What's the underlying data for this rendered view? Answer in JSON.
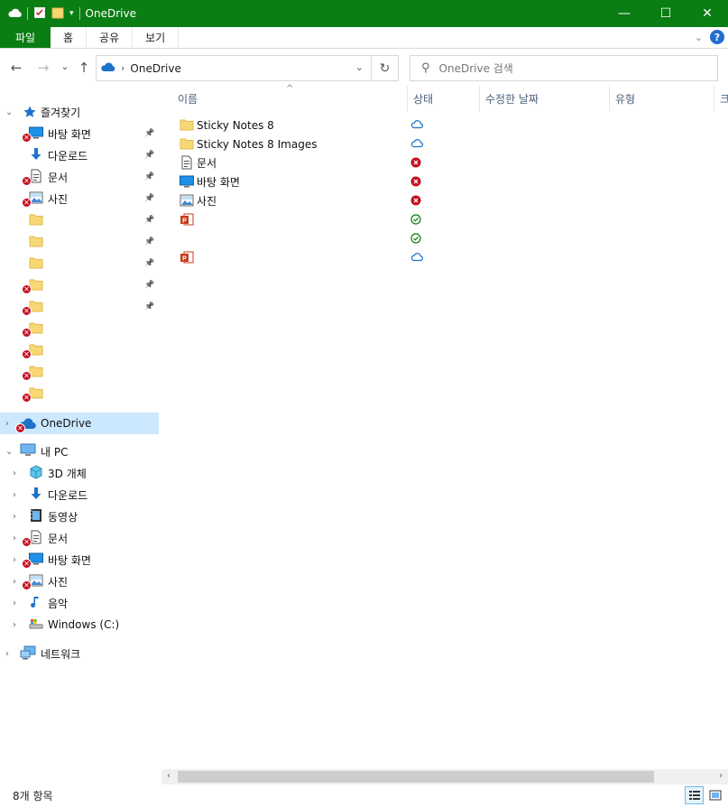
{
  "window": {
    "title": "OneDrive",
    "minimize_label": "—",
    "maximize_label": "☐",
    "close_label": "✕"
  },
  "ribbon": {
    "tabs": [
      "파일",
      "홈",
      "공유",
      "보기"
    ]
  },
  "navigation": {
    "back_label": "←",
    "forward_label": "→",
    "recent_label": "⌄",
    "up_label": "↑",
    "address_crumbs": [
      "OneDrive"
    ],
    "refresh_label": "↻",
    "search_placeholder": "OneDrive 검색"
  },
  "sidebar": {
    "quick_access_label": "즐겨찾기",
    "quick_access_items": [
      {
        "label": "바탕 화면",
        "icon": "desktop-icon",
        "pinned": true,
        "error": true
      },
      {
        "label": "다운로드",
        "icon": "download-icon",
        "pinned": true,
        "error": false
      },
      {
        "label": "문서",
        "icon": "document-icon",
        "pinned": true,
        "error": true
      },
      {
        "label": "사진",
        "icon": "pictures-icon",
        "pinned": true,
        "error": true
      },
      {
        "label": "",
        "icon": "folder-icon",
        "pinned": true,
        "error": false
      },
      {
        "label": "",
        "icon": "folder-icon",
        "pinned": true,
        "error": false
      },
      {
        "label": "",
        "icon": "folder-icon",
        "pinned": true,
        "error": false
      },
      {
        "label": "",
        "icon": "folder-icon",
        "pinned": true,
        "error": true
      },
      {
        "label": "",
        "icon": "folder-icon",
        "pinned": true,
        "error": true
      },
      {
        "label": "",
        "icon": "folder-icon",
        "pinned": false,
        "error": true
      },
      {
        "label": "",
        "icon": "folder-icon",
        "pinned": false,
        "error": true
      },
      {
        "label": "",
        "icon": "folder-icon",
        "pinned": false,
        "error": true
      },
      {
        "label": "",
        "icon": "folder-icon",
        "pinned": false,
        "error": true
      }
    ],
    "onedrive_label": "OneDrive",
    "this_pc_label": "내 PC",
    "this_pc_items": [
      {
        "label": "3D 개체",
        "icon": "3d-objects-icon",
        "error": false
      },
      {
        "label": "다운로드",
        "icon": "download-icon",
        "error": false
      },
      {
        "label": "동영상",
        "icon": "videos-icon",
        "error": false
      },
      {
        "label": "문서",
        "icon": "document-icon",
        "error": true
      },
      {
        "label": "바탕 화면",
        "icon": "desktop-icon",
        "error": true
      },
      {
        "label": "사진",
        "icon": "pictures-icon",
        "error": true
      },
      {
        "label": "음악",
        "icon": "music-icon",
        "error": false
      },
      {
        "label": "Windows  (C:)",
        "icon": "drive-icon",
        "error": false
      }
    ],
    "network_label": "네트워크"
  },
  "columns": {
    "name": "이름",
    "status": "상태",
    "date_modified": "수정한 날짜",
    "type": "유형",
    "size_partial": "크"
  },
  "files": [
    {
      "name": "Sticky Notes 8",
      "icon": "folder-icon",
      "status": "cloud"
    },
    {
      "name": "Sticky Notes 8 Images",
      "icon": "folder-icon",
      "status": "cloud"
    },
    {
      "name": "문서",
      "icon": "document-icon",
      "status": "error"
    },
    {
      "name": "바탕 화면",
      "icon": "desktop-icon",
      "status": "error"
    },
    {
      "name": "사진",
      "icon": "pictures-icon",
      "status": "error"
    },
    {
      "name": "",
      "icon": "powerpoint-icon",
      "status": "synced"
    },
    {
      "name": "",
      "icon": "none",
      "status": "synced"
    },
    {
      "name": "",
      "icon": "powerpoint-icon",
      "status": "cloud"
    }
  ],
  "statusbar": {
    "item_count": "8개 항목"
  },
  "colors": {
    "accent": "#0a7d13",
    "selection": "#cce8ff",
    "error": "#c50f1f",
    "synced": "#107c10",
    "cloud": "#1a73c9"
  }
}
